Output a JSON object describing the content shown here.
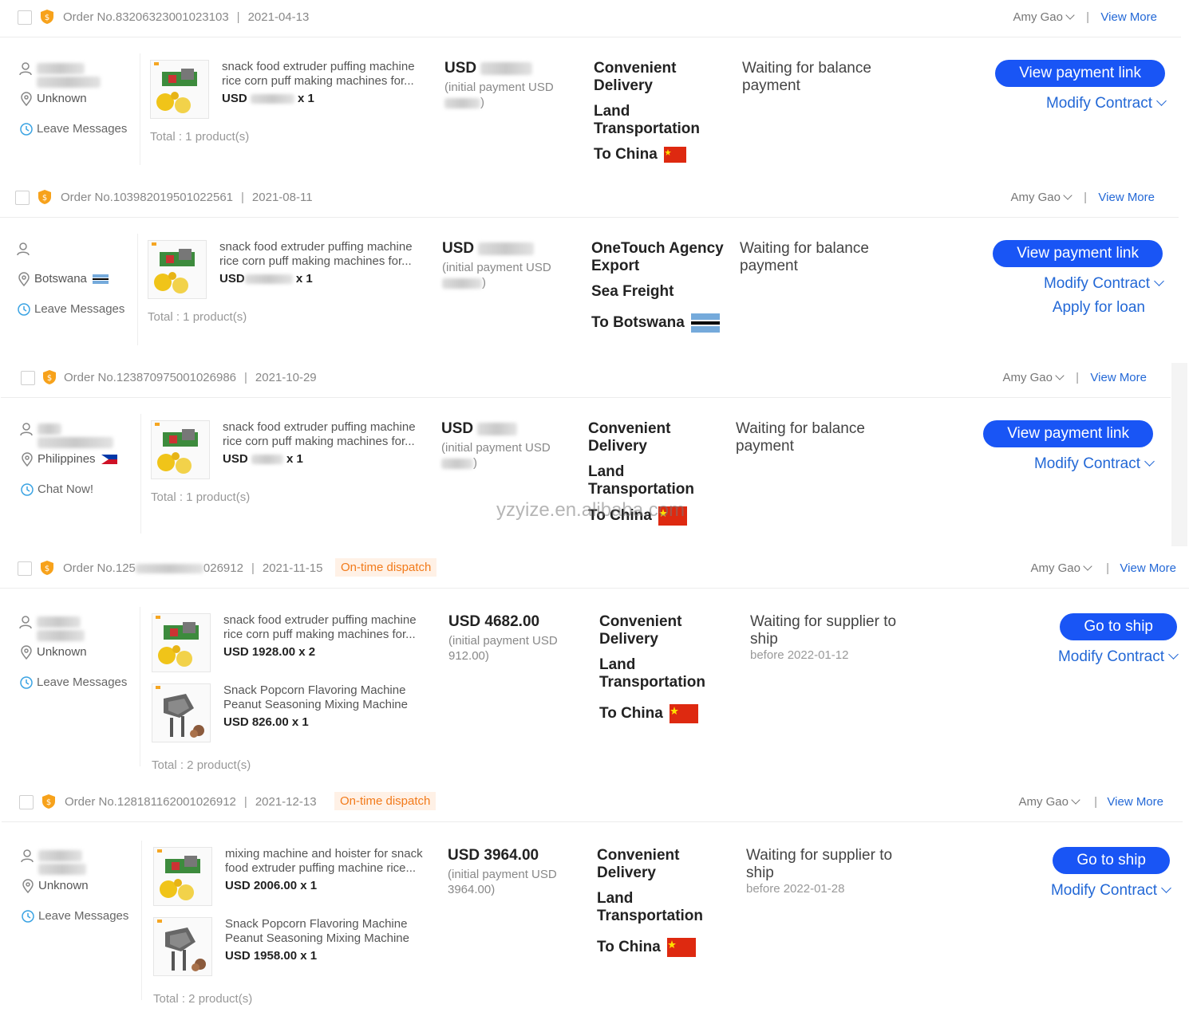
{
  "labels": {
    "view_more": "View More",
    "leave_messages": "Leave Messages",
    "chat_now": "Chat Now!",
    "initial_payment_prefix": "(initial payment USD",
    "view_payment_link": "View payment link",
    "modify_contract": "Modify Contract",
    "apply_for_loan": "Apply for loan",
    "go_to_ship": "Go to ship",
    "usd": "USD"
  },
  "watermark": "yzyize.en.alibaba.com",
  "colors": {
    "primary": "#1955f5",
    "link": "#2368d6",
    "badge_text": "#f27a1a",
    "badge_bg": "#fff1e6"
  },
  "orders": [
    {
      "order_no": "Order No.83206323001023103",
      "date": "2021-04-13",
      "badge": "",
      "agent": "Amy Gao",
      "buyer_location": "Unknown",
      "contact_label": "Leave Messages",
      "products": [
        {
          "name": "snack food extruder puffing machine rice corn puff making machines for...",
          "price": "USD",
          "qty": "x 1"
        }
      ],
      "total": "Total : 1 product(s)",
      "amount": "USD",
      "initial_payment": "(initial payment USD",
      "shipping": [
        "Convenient Delivery",
        "Land Transportation",
        "To China"
      ],
      "status": "Waiting for balance payment",
      "status_sub": "",
      "primary_action": "View payment link",
      "secondary_actions": [
        "Modify Contract"
      ]
    },
    {
      "order_no": "Order No.103982019501022561",
      "date": "2021-08-11",
      "badge": "",
      "agent": "Amy Gao",
      "buyer_location": "Botswana",
      "contact_label": "Leave Messages",
      "products": [
        {
          "name": "snack food extruder puffing machine rice corn puff making machines for...",
          "price": "USD",
          "qty": "x 1"
        }
      ],
      "total": "Total : 1 product(s)",
      "amount": "USD",
      "initial_payment": "(initial payment USD",
      "shipping": [
        "OneTouch Agency Export",
        "Sea Freight",
        "To Botswana"
      ],
      "status": "Waiting for balance payment",
      "status_sub": "",
      "primary_action": "View payment link",
      "secondary_actions": [
        "Modify Contract",
        "Apply for loan"
      ]
    },
    {
      "order_no": "Order No.123870975001026986",
      "date": "2021-10-29",
      "badge": "",
      "agent": "Amy Gao",
      "buyer_location": "Philippines",
      "contact_label": "Chat Now!",
      "products": [
        {
          "name": "snack food extruder puffing machine rice corn puff making machines for...",
          "price": "USD",
          "qty": "x 1"
        }
      ],
      "total": "Total : 1 product(s)",
      "amount": "USD",
      "initial_payment": "(initial payment USD",
      "shipping": [
        "Convenient Delivery",
        "Land Transportation",
        "To China"
      ],
      "status": "Waiting for balance payment",
      "status_sub": "",
      "primary_action": "View payment link",
      "secondary_actions": [
        "Modify Contract"
      ]
    },
    {
      "order_no": "Order No.125",
      "order_no_tail": "026912",
      "date": "2021-11-15",
      "badge": "On-time dispatch",
      "agent": "Amy Gao",
      "buyer_location": "Unknown",
      "contact_label": "Leave Messages",
      "products": [
        {
          "name": "snack food extruder puffing machine rice corn puff making machines for...",
          "price": "USD 1928.00",
          "qty": "x 2"
        },
        {
          "name": "Snack Popcorn Flavoring Machine Peanut Seasoning Mixing Machine",
          "price": "USD 826.00",
          "qty": "x 1"
        }
      ],
      "total": "Total : 2 product(s)",
      "amount": "USD 4682.00",
      "initial_payment": "(initial payment USD 912.00)",
      "shipping": [
        "Convenient Delivery",
        "Land Transportation",
        "To China"
      ],
      "status": "Waiting for supplier to ship",
      "status_sub": "before 2022-01-12",
      "primary_action": "Go to ship",
      "secondary_actions": [
        "Modify Contract"
      ]
    },
    {
      "order_no": "Order No.128181162001026912",
      "date": "2021-12-13",
      "badge": "On-time dispatch",
      "agent": "Amy Gao",
      "buyer_location": "Unknown",
      "contact_label": "Leave Messages",
      "products": [
        {
          "name": "mixing machine and hoister for snack food extruder puffing machine rice...",
          "price": "USD 2006.00",
          "qty": "x 1"
        },
        {
          "name": "Snack Popcorn Flavoring Machine Peanut Seasoning Mixing Machine",
          "price": "USD 1958.00",
          "qty": "x 1"
        }
      ],
      "total": "Total : 2 product(s)",
      "amount": "USD 3964.00",
      "initial_payment": "(initial payment USD 3964.00)",
      "shipping": [
        "Convenient Delivery",
        "Land Transportation",
        "To China"
      ],
      "status": "Waiting for supplier to ship",
      "status_sub": "before 2022-01-28",
      "primary_action": "Go to ship",
      "secondary_actions": [
        "Modify Contract"
      ]
    }
  ]
}
